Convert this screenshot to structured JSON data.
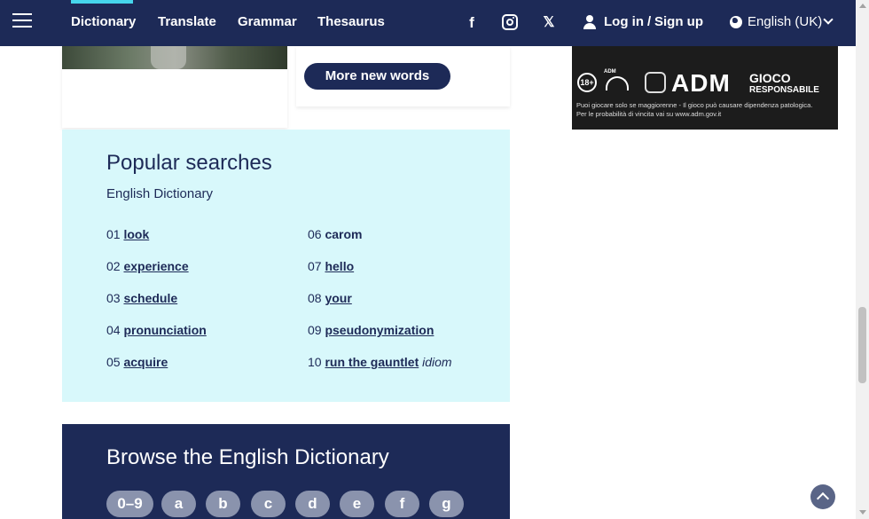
{
  "header": {
    "nav": {
      "dictionary": "Dictionary",
      "translate": "Translate",
      "grammar": "Grammar",
      "thesaurus": "Thesaurus"
    },
    "social": {
      "facebook_glyph": "f",
      "x_glyph": "𝕏"
    },
    "login": "Log in",
    "separator": "/",
    "signup": "Sign up",
    "language": "English (UK)"
  },
  "cards": {
    "more_new_words": "More new words"
  },
  "ad": {
    "age": "18+",
    "adm_small": "ADM",
    "adm": "ADM",
    "gioco": "GIOCO",
    "responsabile": "RESPONSABILE",
    "line1": "Puoi giocare solo se maggiorenne - Il gioco può causare dipendenza patologica.",
    "line2": "Per le probabilità di vincita vai su www.adm.gov.it"
  },
  "popular": {
    "title": "Popular searches",
    "subtitle": "English Dictionary",
    "left": [
      {
        "num": "01",
        "word": "look"
      },
      {
        "num": "02",
        "word": "experience"
      },
      {
        "num": "03",
        "word": "schedule"
      },
      {
        "num": "04",
        "word": "pronunciation"
      },
      {
        "num": "05",
        "word": "acquire"
      }
    ],
    "right": [
      {
        "num": "06",
        "word": "carom"
      },
      {
        "num": "07",
        "word": "hello"
      },
      {
        "num": "08",
        "word": "your"
      },
      {
        "num": "09",
        "word": "pseudonymization"
      },
      {
        "num": "10",
        "word": "run the gauntlet",
        "tag": "idiom"
      }
    ]
  },
  "browse": {
    "title": "Browse the English Dictionary",
    "letters": [
      "0–9",
      "a",
      "b",
      "c",
      "d",
      "e",
      "f",
      "g"
    ]
  },
  "icons": {
    "menu": "hamburger-menu-icon",
    "facebook": "facebook-icon",
    "instagram": "instagram-icon",
    "x": "x-twitter-icon",
    "user": "user-icon",
    "globe": "globe-icon",
    "chevron": "chevron-down-icon",
    "back_to_top": "back-to-top-icon"
  },
  "colors": {
    "brand_navy": "#1d2a57",
    "accent_cyan": "#46d6ec",
    "popular_bg": "#d8f8fb"
  }
}
